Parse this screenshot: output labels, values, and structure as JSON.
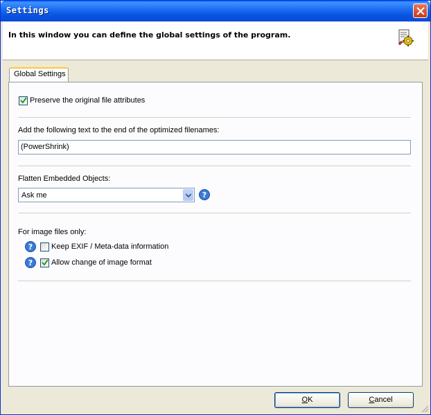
{
  "window": {
    "title": "Settings"
  },
  "header": {
    "description": "In this window you can define the global settings of the program."
  },
  "tabs": [
    {
      "label": "Global Settings",
      "active": true
    }
  ],
  "settings": {
    "preserve_attributes": {
      "label": "Preserve the original file attributes",
      "checked": true
    },
    "filename_suffix": {
      "label": "Add the following text to the end of the optimized filenames:",
      "value": "(PowerShrink)"
    },
    "flatten": {
      "label": "Flatten Embedded Objects:",
      "selected": "Ask me"
    },
    "image_files": {
      "label": "For image files only:",
      "keep_exif": {
        "label": "Keep EXIF / Meta-data information",
        "checked": false
      },
      "allow_format_change": {
        "label": "Allow change of image format",
        "checked": true
      }
    }
  },
  "buttons": {
    "ok_accel": "O",
    "ok_rest": "K",
    "cancel_accel": "C",
    "cancel_rest": "ancel"
  },
  "colors": {
    "titlebar": "#0a5ef6",
    "dialog_bg": "#ece9d8",
    "help_icon": "#3a7bd5"
  }
}
